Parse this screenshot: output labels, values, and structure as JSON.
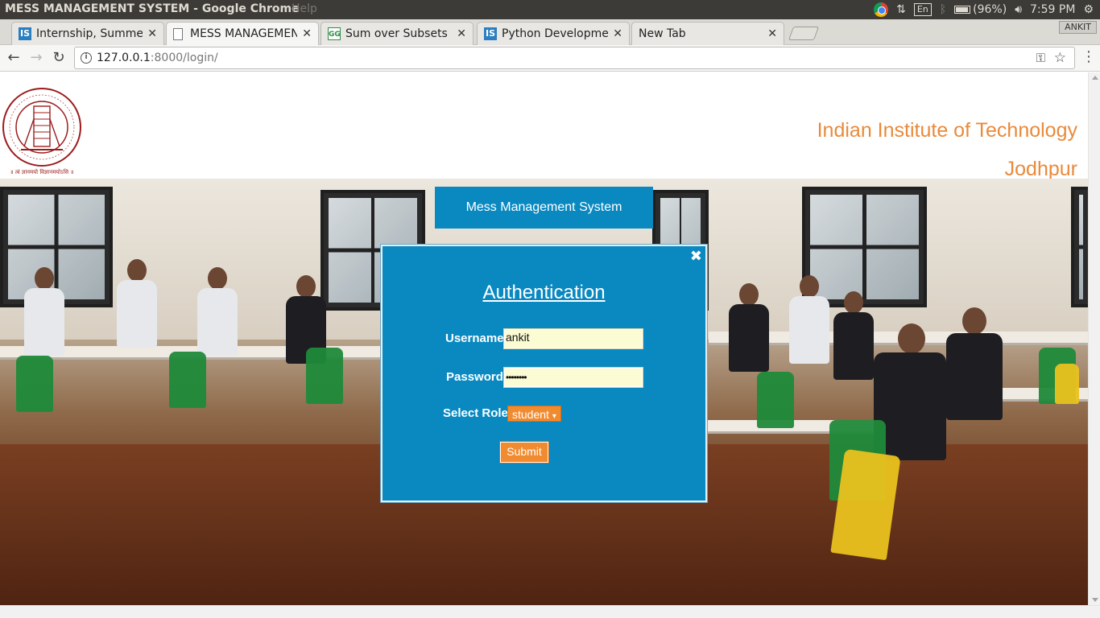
{
  "os": {
    "window_title": "MESS MANAGEMENT SYSTEM - Google Chrome",
    "ghost_menu": "Help",
    "tray": {
      "lang": "En",
      "battery": "(96%)",
      "time": "7:59 PM"
    }
  },
  "browser": {
    "tabs": [
      {
        "label": "Internship, Summer",
        "favicon": "IS"
      },
      {
        "label": "MESS MANAGEMENT",
        "favicon": "doc"
      },
      {
        "label": "Sum over Subsets |",
        "favicon": "GfG"
      },
      {
        "label": "Python Developme",
        "favicon": "IS"
      },
      {
        "label": "New Tab",
        "favicon": ""
      }
    ],
    "profile": "ANKIT",
    "url_host": "127.0.0.1",
    "url_rest": ":8000/login/"
  },
  "page": {
    "institute_line1": "Indian Institute of Technology",
    "institute_line2": "Jodhpur",
    "logo_motto": "॥ त्वं ज्ञानमयो विज्ञानमयोऽसि ॥",
    "system_title": "Mess Management System",
    "auth": {
      "title": "Authentication",
      "username_label": "Username",
      "username_value": "ankit",
      "password_label": "Password",
      "password_value": "••••••••",
      "role_label": "Select Role",
      "role_value": "student",
      "submit_label": "Submit",
      "close_symbol": "✖"
    }
  },
  "colors": {
    "accent_blue": "#0a89c1",
    "accent_orange": "#f18b2f",
    "institute_orange": "#e98a3a"
  }
}
